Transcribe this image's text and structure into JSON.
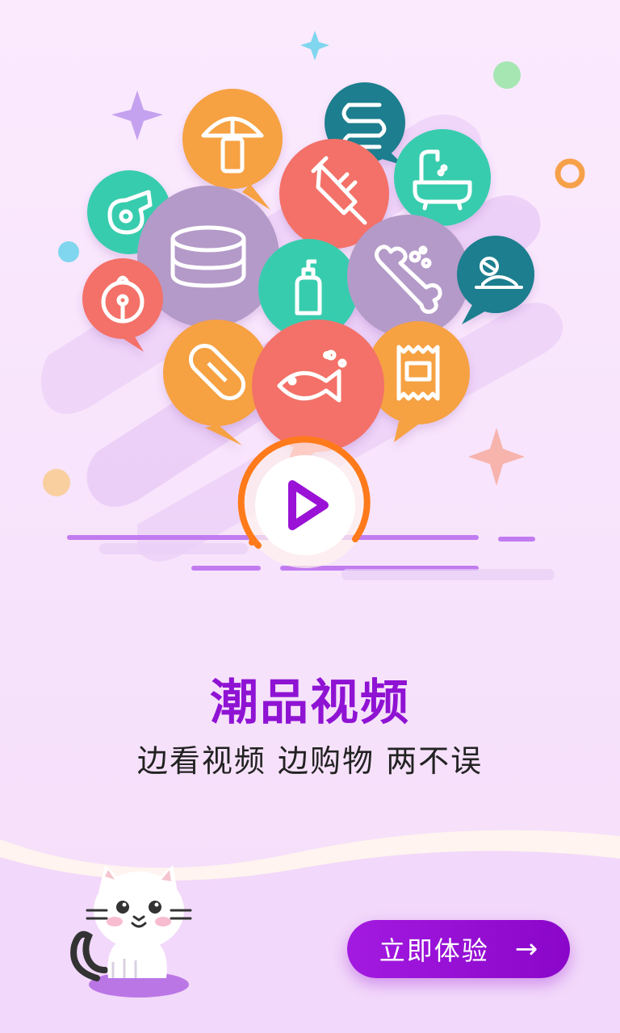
{
  "page": {
    "title": "潮品视频",
    "subtitle": "边看视频 边购物 两不误"
  },
  "cta": {
    "label": "立即体验",
    "arrow": "→"
  },
  "hero": {
    "play_icon": "play-icon",
    "bubbles": [
      {
        "icon": "mushroom-icon",
        "color": "#f6a142"
      },
      {
        "icon": "spring-icon",
        "color": "#1c7e8e"
      },
      {
        "icon": "bathtub-icon",
        "color": "#39ccae"
      },
      {
        "icon": "whistle-icon",
        "color": "#39ccae"
      },
      {
        "icon": "food-can-icon",
        "color": "#b49ac8"
      },
      {
        "icon": "syringe-icon",
        "color": "#f37168"
      },
      {
        "icon": "bell-icon",
        "color": "#f37168"
      },
      {
        "icon": "shampoo-bottle-icon",
        "color": "#39ccae"
      },
      {
        "icon": "bone-icon",
        "color": "#b49ac8"
      },
      {
        "icon": "toy-mouse-icon",
        "color": "#1c7e8e"
      },
      {
        "icon": "pill-icon",
        "color": "#f6a142"
      },
      {
        "icon": "fish-icon",
        "color": "#f37168"
      },
      {
        "icon": "snack-bag-icon",
        "color": "#f6a142"
      }
    ]
  },
  "colors": {
    "accent": "#8f13d3",
    "ring": "#ff7a1a",
    "background": "#f7e3fb"
  }
}
